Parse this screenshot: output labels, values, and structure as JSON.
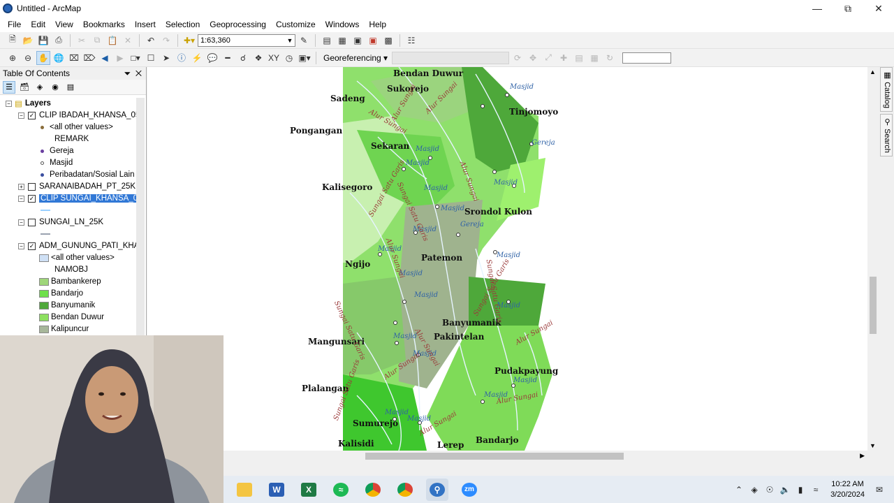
{
  "window": {
    "title": "Untitled - ArcMap"
  },
  "menu": [
    "File",
    "Edit",
    "View",
    "Bookmarks",
    "Insert",
    "Selection",
    "Geoprocessing",
    "Customize",
    "Windows",
    "Help"
  ],
  "toolbar": {
    "scale": "1:63,360",
    "georeferencing_label": "Georeferencing ▾"
  },
  "toc": {
    "title": "Table Of Contents",
    "layers_root": "Layers",
    "items": [
      {
        "label": "CLIP IBADAH_KHANSA_05",
        "checked": true
      },
      {
        "label": "<all other values>"
      },
      {
        "label": "REMARK"
      },
      {
        "label": "Gereja"
      },
      {
        "label": "Masjid"
      },
      {
        "label": "Peribadatan/Sosial Lain"
      },
      {
        "label": "SARANAIBADAH_PT_25K",
        "checked": false
      },
      {
        "label": "CLIP SUNGAI_KHANSA_05",
        "checked": true
      },
      {
        "label": "SUNGAI_LN_25K",
        "checked": false
      },
      {
        "label": "ADM_GUNUNG_PATI_KHA",
        "checked": true
      },
      {
        "label": "<all other values>"
      },
      {
        "label": "NAMOBJ"
      },
      {
        "label": "Bambankerep"
      },
      {
        "label": "Bandarjo"
      },
      {
        "label": "Banyumanik"
      },
      {
        "label": "Bendan Duwur"
      },
      {
        "label": "Kalipuncur"
      }
    ],
    "swatch_colors": [
      "#9fd67a",
      "#6ee04a",
      "#4fa83a",
      "#8de05f",
      "#a7b79a"
    ]
  },
  "map": {
    "village_labels": [
      "Bendan Duwur",
      "Sukorejo",
      "Sadeng",
      "Tinjomoyo",
      "Pongangan",
      "Sekaran",
      "Kalisegoro",
      "Srondol Kulon",
      "Patemon",
      "Ngijo",
      "Banyumanik",
      "Pakintelan",
      "Mangunsari",
      "Pudakpayung",
      "Plalangan",
      "Sumurejo",
      "Kalisidi",
      "Lerep",
      "Bandarjo"
    ],
    "worship_labels": [
      "Masjid",
      "Gereja",
      "Masjid",
      "Masjid",
      "Masjid",
      "Masjid",
      "Masjid",
      "Gereja",
      "Masjid",
      "Masjid",
      "Masjid",
      "Masjid",
      "Masjid",
      "Masjid",
      "Masjid",
      "Masjid",
      "Masjid",
      "Masjid",
      "Masjid",
      "Masjid"
    ],
    "river_labels": [
      "Alur Sungai",
      "Alur Sungai",
      "Alur Sungai",
      "Sungai Satu Garis",
      "Alur Sungai",
      "Sungai Satu Garis",
      "Alur Sungai",
      "Sungai Satu Garis",
      "Alur Sungai",
      "Sungai Satu Garis",
      "Alur Sungai",
      "Alur Sungai",
      "Sungai Satu Garis",
      "Alur Sungai",
      "Alur Sungai",
      "Sungai Satu Garis"
    ]
  },
  "side_tabs": [
    "Catalog",
    "Search"
  ],
  "clock": {
    "time": "10:22 AM",
    "date": "3/20/2024"
  }
}
